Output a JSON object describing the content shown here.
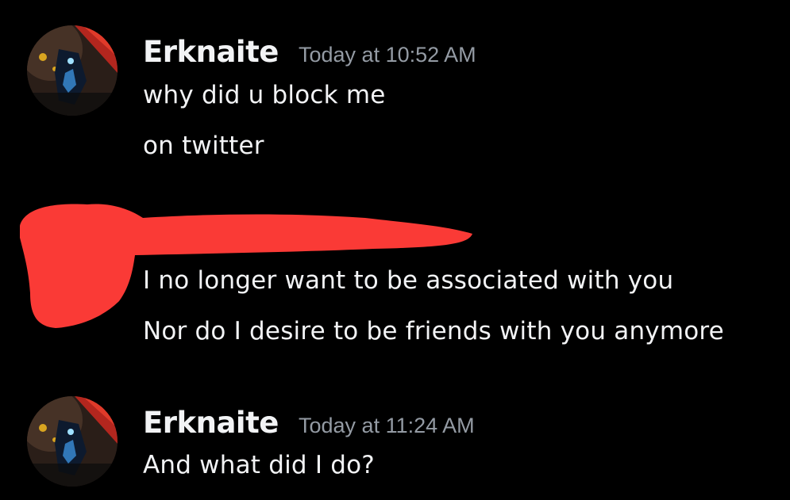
{
  "colors": {
    "background": "#000000",
    "text": "#f2f3f5",
    "timestamp": "#949ba4",
    "redaction": "#fa3a36"
  },
  "messages": [
    {
      "avatar_icon": "user-avatar-icon",
      "author": "Erknaite",
      "timestamp": "Today at 10:52 AM",
      "lines": [
        "why did u block me",
        "on twitter"
      ]
    },
    {
      "redacted": true,
      "lines": [
        "I no longer want to be associated with you",
        "Nor do I desire to be friends with you anymore"
      ]
    },
    {
      "avatar_icon": "user-avatar-icon",
      "author": "Erknaite",
      "timestamp": "Today at 11:24 AM",
      "lines": [
        "And what did I do?"
      ]
    }
  ]
}
